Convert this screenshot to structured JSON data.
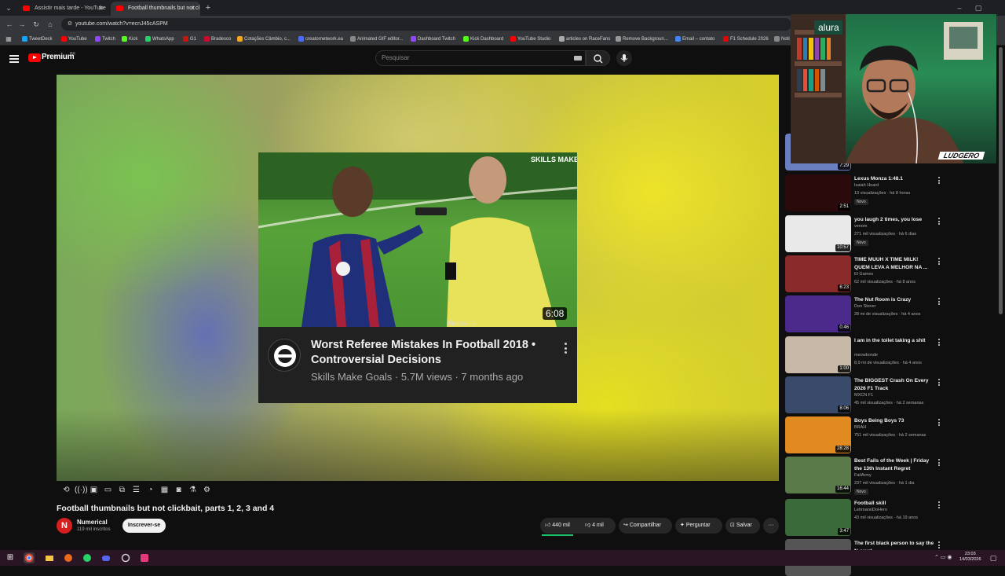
{
  "browser": {
    "tabs": [
      {
        "label": "Assistir mais tarde - YouTube"
      },
      {
        "label": "Football thumbnails but not cl"
      }
    ],
    "new_tab": "+",
    "url": "youtube.com/watch?v=ecnJ45cASPM",
    "bookmarks": [
      {
        "label": "TweetDeck",
        "color": "#1da1f2"
      },
      {
        "label": "YouTube",
        "color": "#ff0000"
      },
      {
        "label": "Twitch",
        "color": "#9146ff"
      },
      {
        "label": "Kick",
        "color": "#53fc18"
      },
      {
        "label": "WhatsApp",
        "color": "#25d366"
      },
      {
        "label": "G1",
        "color": "#c4170c"
      },
      {
        "label": "Bradesco",
        "color": "#cc092f"
      },
      {
        "label": "Cotações Câmbio, c...",
        "color": "#f5a623"
      },
      {
        "label": "creatornetwork.ea",
        "color": "#4a6cf7"
      },
      {
        "label": "Animated GIF editor...",
        "color": "#888888"
      },
      {
        "label": "Dashboard Twitch",
        "color": "#9146ff"
      },
      {
        "label": "Kick Dashboard",
        "color": "#53fc18"
      },
      {
        "label": "YouTube Studio",
        "color": "#ff0000"
      },
      {
        "label": "articles on RaceFans",
        "color": "#aaaaaa"
      },
      {
        "label": "Remove Backgroun...",
        "color": "#999999"
      },
      {
        "label": "Email – contato",
        "color": "#4285f4"
      },
      {
        "label": "F1 Schedule 2026",
        "color": "#e10600"
      },
      {
        "label": "Noti",
        "color": "#888888"
      }
    ]
  },
  "youtube": {
    "logo_text": "Premium",
    "region": "BR",
    "search_placeholder": "Pesquisar"
  },
  "player_card": {
    "thumb_watermark": "SKILLS MAKE GOALS",
    "duration": "6:08",
    "title": "Worst Referee Mistakes In Football 2018 • Controversial Decisions",
    "meta": "Skills Make Goals · 5.7M views · 7 months ago",
    "numerical_tag": "Numerical"
  },
  "video": {
    "title": "Football thumbnails but not clickbait, parts 1, 2, 3 and 4",
    "channel": "Numerical",
    "channel_initial": "N",
    "subscribers": "119 mil inscritos",
    "subscribe_label": "Inscrever-se",
    "likes": "440 mil",
    "dislikes": "4 mil",
    "share": "Compartilhar",
    "ask": "Perguntar",
    "save": "Salvar",
    "more": "···"
  },
  "sidebar": {
    "items": [
      {
        "title": "",
        "channel": "",
        "meta": "2,3 mi de visualizações · há 2 anos",
        "duration": "7:29",
        "new": "",
        "thumb": "#6a7fc0"
      },
      {
        "title": "Lexus Monza 1:48.1",
        "channel": "Isaiah Hoard",
        "meta": "13 visualizações · há 8 horas",
        "duration": "2:51",
        "new": "Novo",
        "thumb": "#2a0a0a"
      },
      {
        "title": "you laugh 2 times, you lose",
        "channel": "venom",
        "meta": "271 mil visualizações · há 6 dias",
        "duration": "10:57",
        "new": "Novo",
        "thumb": "#e9e9e9"
      },
      {
        "title": "TIME MUUH X TIME MILK! QUEM LEVA A MELHOR NA ...",
        "channel": "El Games",
        "meta": "62 mil visualizações · há 8 anos",
        "duration": "6:23",
        "new": "",
        "thumb": "#8a2a2a"
      },
      {
        "title": "The Nut Room is Crazy",
        "channel": "Don Stever",
        "meta": "28 mi de visualizações · há 4 anos",
        "duration": "0:46",
        "new": "",
        "thumb": "#4b2a8c"
      },
      {
        "title": "I am in the toilet taking a shit",
        "channel": "meowbonde",
        "meta": "8,9 mi de visualizações · há 4 anos",
        "duration": "1:00",
        "new": "",
        "thumb": "#c8b8a8"
      },
      {
        "title": "The BIGGEST Crash On Every 2026 F1 Track",
        "channel": "MXCN F1",
        "meta": "45 mil visualizações · há 2 semanas",
        "duration": "8:06",
        "new": "",
        "thumb": "#3a4a6a"
      },
      {
        "title": "Boys Being Boys 73",
        "channel": "BRAH",
        "meta": "751 mil visualizações · há 2 semanas",
        "duration": "28:28",
        "new": "",
        "thumb": "#e08a20"
      },
      {
        "title": "Best Fails of the Week | Friday the 13th Instant Regret",
        "channel": "FailArmy",
        "meta": "237 mil visualizações · há 1 dia",
        "duration": "16:44",
        "new": "Novo",
        "thumb": "#5a7a4a"
      },
      {
        "title": "Football skill",
        "channel": "LehmannDoHero",
        "meta": "43 mil visualizações · há 19 anos",
        "duration": "3:47",
        "new": "",
        "thumb": "#3a6a3a"
      },
      {
        "title": "The first black person to say the N-word",
        "channel": "",
        "meta": "",
        "duration": "",
        "new": "",
        "thumb": "#555555"
      }
    ]
  },
  "webcam": {
    "tag": "LUDGERO",
    "sign": "alura"
  },
  "taskbar": {
    "time": "23:03",
    "date": "14/03/2026"
  }
}
